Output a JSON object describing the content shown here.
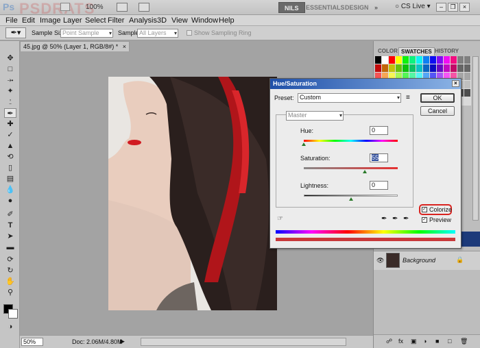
{
  "app": {
    "logo": "Ps",
    "watermark": "PSDRATS",
    "zoom_display": "100%"
  },
  "workspaces": [
    "NILS",
    "ESSENTIALS",
    "DESIGN"
  ],
  "workspace_more": "»",
  "cs_live": "CS Live",
  "menu": [
    "File",
    "Edit",
    "Image",
    "Layer",
    "Select",
    "Filter",
    "Analysis",
    "3D",
    "View",
    "Window",
    "Help"
  ],
  "options": {
    "sample_size_label": "Sample Size:",
    "sample_size_value": "Point Sample",
    "sample_label": "Sample:",
    "sample_value": "All Layers",
    "show_ring": "Show Sampling Ring"
  },
  "document": {
    "tab_title": "45.jpg @ 50% (Layer 1, RGB/8#) *",
    "close": "×"
  },
  "status": {
    "zoom": "50%",
    "doc": "Doc: 2.06M/4.80M"
  },
  "panels": {
    "tabs": [
      "COLOR",
      "SWATCHES",
      "HISTORY"
    ],
    "active": "SWATCHES"
  },
  "layers": {
    "background_name": "Background"
  },
  "dialog": {
    "title": "Hue/Saturation",
    "preset_label": "Preset:",
    "preset_value": "Custom",
    "channel": "Master",
    "hue_label": "Hue:",
    "hue_value": "0",
    "saturation_label": "Saturation:",
    "saturation_value": "55",
    "lightness_label": "Lightness:",
    "lightness_value": "0",
    "ok": "OK",
    "cancel": "Cancel",
    "colorize": "Colorize",
    "preview": "Preview",
    "colorize_checked": true,
    "preview_checked": true,
    "hue_level": 0,
    "saturation_level": 0.65,
    "lightness_level": 0.5,
    "colorize_highlight": "#d9231f"
  }
}
